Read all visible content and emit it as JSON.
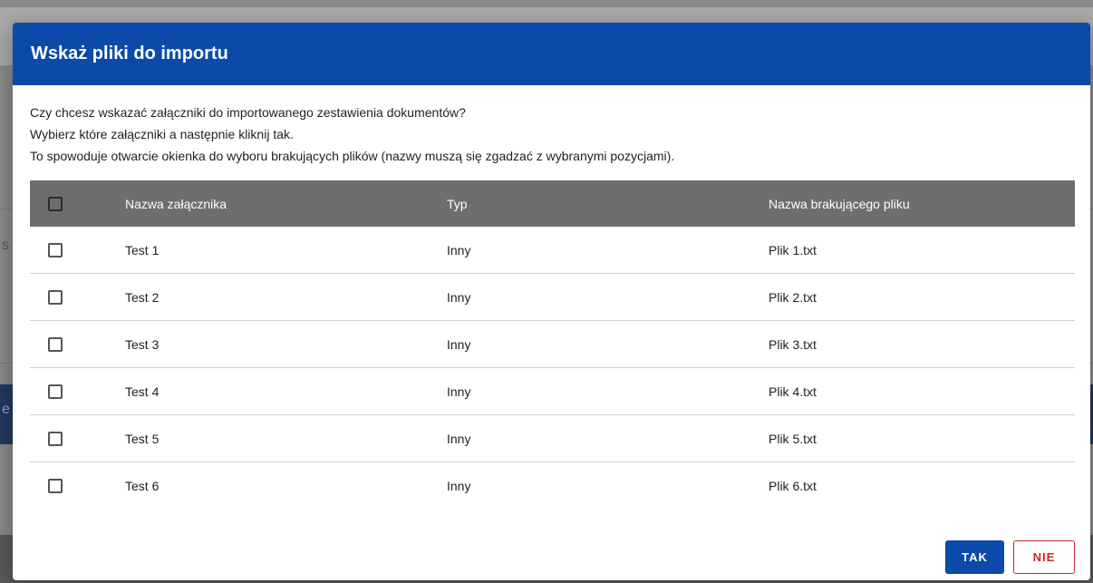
{
  "dialog": {
    "title": "Wskaż pliki do importu",
    "description": [
      "Czy chcesz wskazać załączniki do importowanego zestawienia dokumentów?",
      "Wybierz które załączniki a następnie kliknij tak.",
      "To spowoduje otwarcie okienka do wyboru brakujących plików (nazwy muszą się zgadzać z wybranymi pozycjami)."
    ],
    "table": {
      "headers": {
        "name": "Nazwa załącznika",
        "type": "Typ",
        "file": "Nazwa brakującego pliku"
      },
      "select_all_checked": false,
      "rows": [
        {
          "checked": false,
          "name": "Test 1",
          "type": "Inny",
          "file": "Plik 1.txt"
        },
        {
          "checked": false,
          "name": "Test 2",
          "type": "Inny",
          "file": "Plik 2.txt"
        },
        {
          "checked": false,
          "name": "Test 3",
          "type": "Inny",
          "file": "Plik 3.txt"
        },
        {
          "checked": false,
          "name": "Test 4",
          "type": "Inny",
          "file": "Plik 4.txt"
        },
        {
          "checked": false,
          "name": "Test 5",
          "type": "Inny",
          "file": "Plik 5.txt"
        },
        {
          "checked": false,
          "name": "Test 6",
          "type": "Inny",
          "file": "Plik 6.txt"
        }
      ]
    },
    "buttons": {
      "yes_label": "TAK",
      "no_label": "NIE"
    }
  },
  "colors": {
    "header_blue": "#0b4aa8",
    "table_header_gray": "#6e6e6e",
    "no_button_red": "#c62828",
    "overlay_gray": "#8a8a8a"
  },
  "background": {
    "glyphs": [
      "s",
      "e"
    ]
  }
}
